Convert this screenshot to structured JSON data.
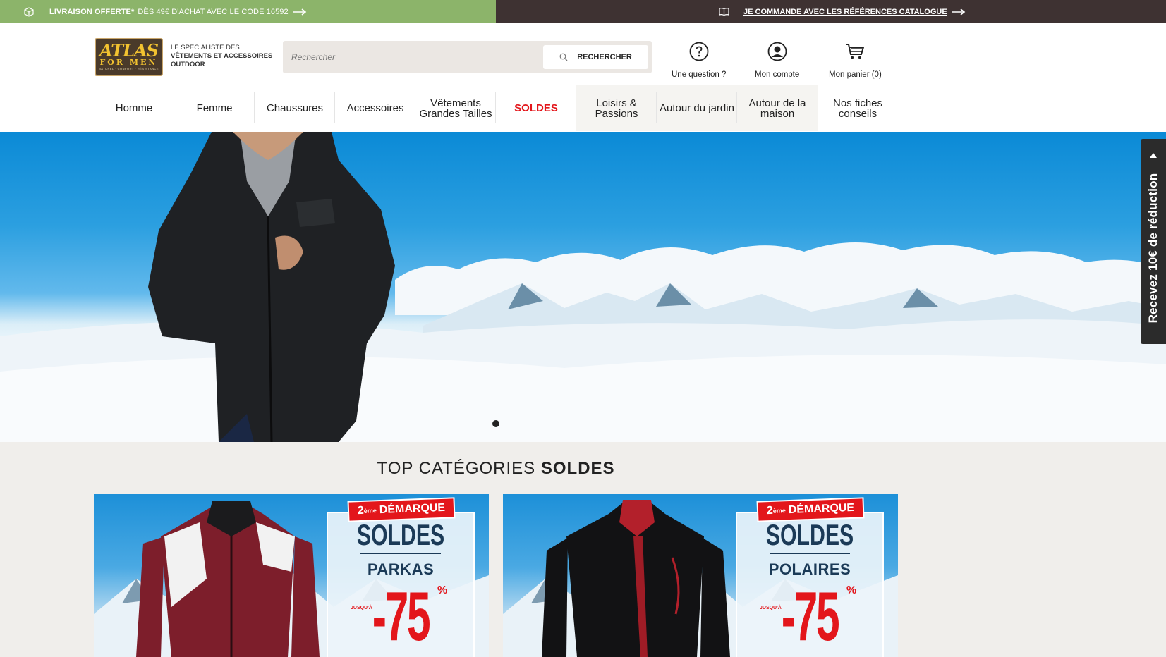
{
  "topbar": {
    "left_bold": "LIVRAISON OFFERTE*",
    "left_text": "DÈS 49€ D'ACHAT AVEC LE CODE 16592",
    "right_link": "JE COMMANDE AVEC LES RÉFÉRENCES CATALOGUE",
    "left_bg": "#8cb46a",
    "right_bg": "#3e3232"
  },
  "logo": {
    "main": "ATLAS",
    "sub": "FOR MEN",
    "tag": "NATUREL · CONFORT · RÉSISTANCE"
  },
  "tagline": {
    "line1": "LE SPÉCIALISTE DES",
    "line2": "VÊTEMENTS ET ACCESSOIRES",
    "line3": "OUTDOOR"
  },
  "search": {
    "placeholder": "Rechercher",
    "button": "RECHERCHER"
  },
  "header_links": {
    "question": "Une question ?",
    "account": "Mon compte",
    "cart": "Mon panier (0)"
  },
  "nav": {
    "items": [
      "Homme",
      "Femme",
      "Chaussures",
      "Accessoires",
      "Vêtements Grandes Tailles",
      "SOLDES",
      "Loisirs & Passions",
      "Autour du jardin",
      "Autour de la maison",
      "Nos fiches conseils"
    ],
    "sale_color": "#e3161b"
  },
  "sidetab": {
    "label": "Recevez 10€ de réduction"
  },
  "categories": {
    "title_light": "TOP CATÉGORIES",
    "title_bold": "SOLDES",
    "cards": [
      {
        "ribbon_sup": "ème",
        "ribbon_pre": "2",
        "ribbon": "DÉMARQUE",
        "soldes": "SOLDES",
        "category": "PARKAS",
        "jusqua": "JUSQU'À",
        "discount": "-75",
        "percent": "%"
      },
      {
        "ribbon_sup": "ème",
        "ribbon_pre": "2",
        "ribbon": "DÉMARQUE",
        "soldes": "SOLDES",
        "category": "POLAIRES",
        "jusqua": "JUSQU'À",
        "discount": "-75",
        "percent": "%"
      }
    ]
  }
}
